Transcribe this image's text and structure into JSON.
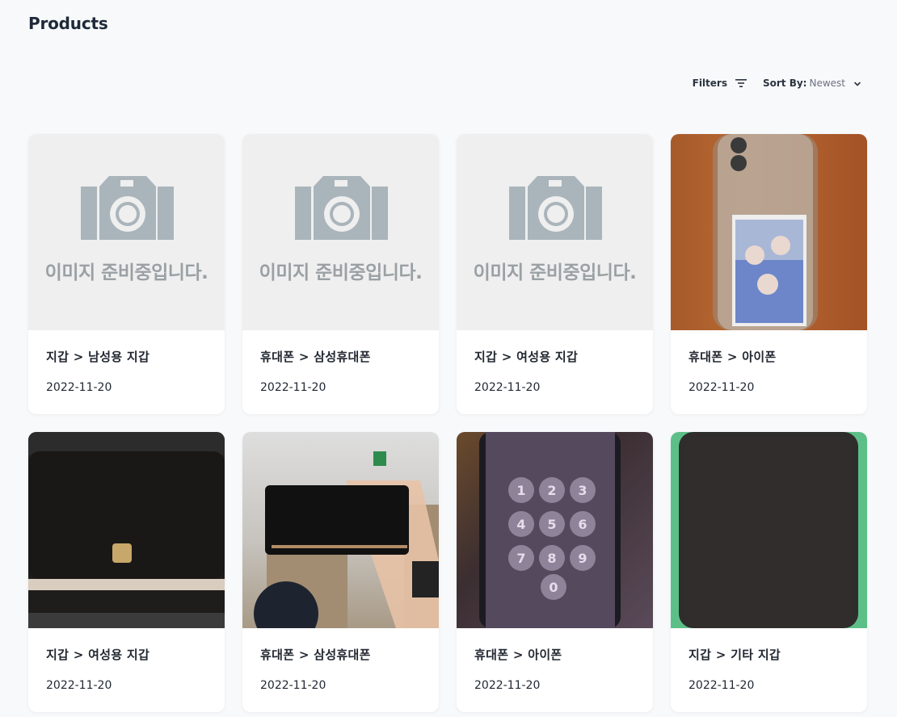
{
  "page": {
    "title": "Products"
  },
  "toolbar": {
    "filters_label": "Filters",
    "sort_label": "Sort By:",
    "sort_value": "Newest"
  },
  "products": [
    {
      "category": "지갑 > 남성용 지갑",
      "date": "2022-11-20",
      "image": "placeholder",
      "placeholder_text": "이미지 준비중입니다."
    },
    {
      "category": "휴대폰 > 삼성휴대폰",
      "date": "2022-11-20",
      "image": "placeholder",
      "placeholder_text": "이미지 준비중입니다."
    },
    {
      "category": "지갑 > 여성용 지갑",
      "date": "2022-11-20",
      "image": "placeholder",
      "placeholder_text": "이미지 준비중입니다."
    },
    {
      "category": "휴대폰 > 아이폰",
      "date": "2022-11-20",
      "image": "photo-phone-case"
    },
    {
      "category": "지갑 > 여성용 지갑",
      "date": "2022-11-20",
      "image": "photo-black-wallet"
    },
    {
      "category": "휴대폰 > 삼성휴대폰",
      "date": "2022-11-20",
      "image": "photo-hand-holding-wallet"
    },
    {
      "category": "휴대폰 > 아이폰",
      "date": "2022-11-20",
      "image": "photo-phone-lock-screen"
    },
    {
      "category": "지갑 > 기타 지갑",
      "date": "2022-11-20",
      "image": "photo-leather-wallet"
    }
  ],
  "colors": {
    "background": "#f8f9fb",
    "placeholder_bg": "#efefef",
    "placeholder_icon": "#aab4bb"
  }
}
